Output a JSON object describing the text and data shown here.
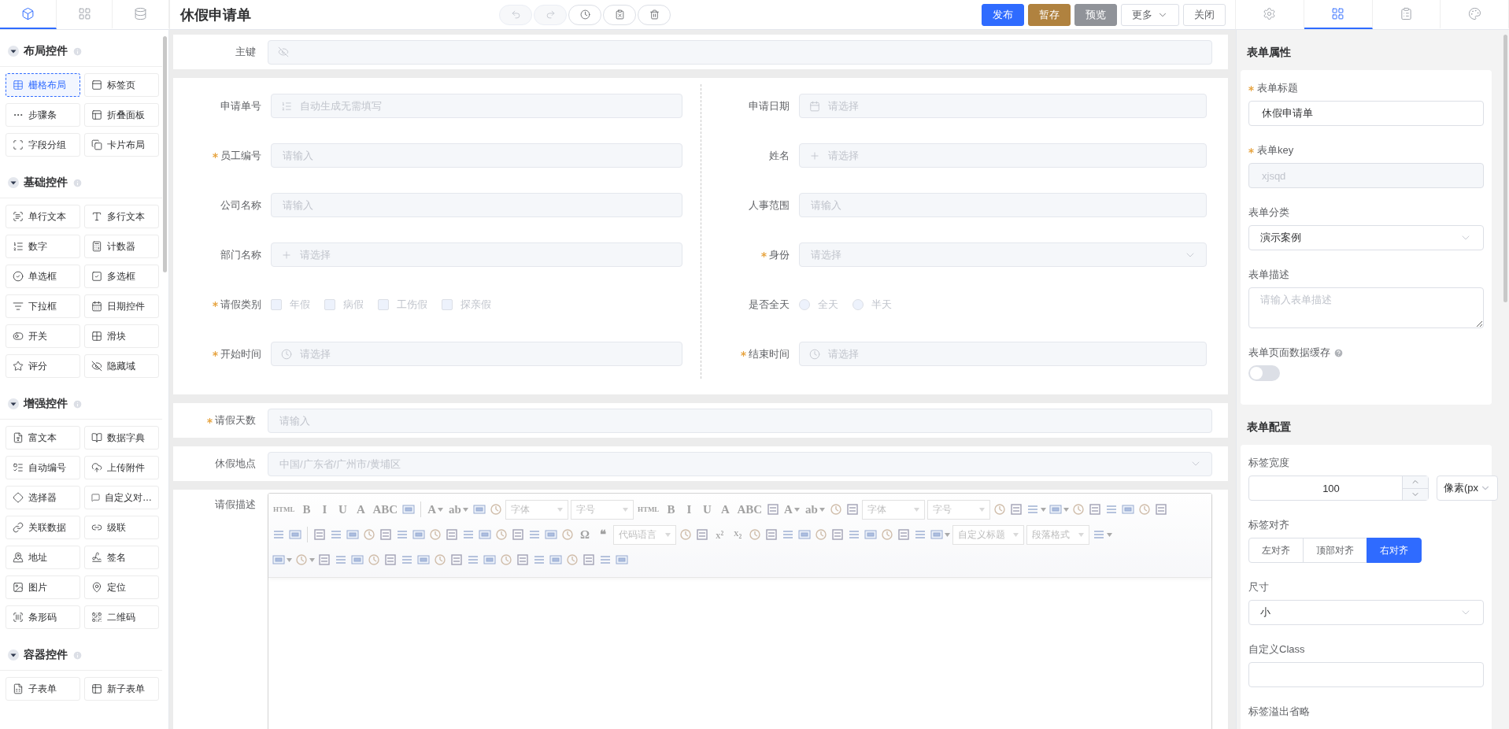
{
  "left_tabs": [
    {
      "kind": "cube",
      "selected": true
    },
    {
      "kind": "grid",
      "selected": false
    },
    {
      "kind": "database",
      "selected": false
    }
  ],
  "palette": [
    {
      "title": "布局控件",
      "items": [
        {
          "label": "栅格布局",
          "selected": true
        },
        {
          "label": "标签页",
          "selected": false
        },
        {
          "label": "步骤条",
          "selected": false
        },
        {
          "label": "折叠面板",
          "selected": false
        },
        {
          "label": "字段分组",
          "selected": false
        },
        {
          "label": "卡片布局",
          "selected": false
        }
      ]
    },
    {
      "title": "基础控件",
      "items": [
        {
          "label": "单行文本",
          "selected": false
        },
        {
          "label": "多行文本",
          "selected": false
        },
        {
          "label": "数字",
          "selected": false
        },
        {
          "label": "计数器",
          "selected": false
        },
        {
          "label": "单选框",
          "selected": false
        },
        {
          "label": "多选框",
          "selected": false
        },
        {
          "label": "下拉框",
          "selected": false
        },
        {
          "label": "日期控件",
          "selected": false
        },
        {
          "label": "开关",
          "selected": false
        },
        {
          "label": "滑块",
          "selected": false
        },
        {
          "label": "评分",
          "selected": false
        },
        {
          "label": "隐藏域",
          "selected": false
        }
      ]
    },
    {
      "title": "增强控件",
      "items": [
        {
          "label": "富文本",
          "selected": false
        },
        {
          "label": "数据字典",
          "selected": false
        },
        {
          "label": "自动编号",
          "selected": false
        },
        {
          "label": "上传附件",
          "selected": false
        },
        {
          "label": "选择器",
          "selected": false
        },
        {
          "label": "自定义对…",
          "selected": false
        },
        {
          "label": "关联数据",
          "selected": false
        },
        {
          "label": "级联",
          "selected": false
        },
        {
          "label": "地址",
          "selected": false
        },
        {
          "label": "签名",
          "selected": false
        },
        {
          "label": "图片",
          "selected": false
        },
        {
          "label": "定位",
          "selected": false
        },
        {
          "label": "条形码",
          "selected": false
        },
        {
          "label": "二维码",
          "selected": false
        }
      ]
    },
    {
      "title": "容器控件",
      "items": [
        {
          "label": "子表单",
          "selected": false
        },
        {
          "label": "新子表单",
          "selected": false
        }
      ]
    }
  ],
  "header": {
    "title": "休假申请单",
    "tools": [
      {
        "kind": "undo",
        "disabled": true
      },
      {
        "kind": "redo",
        "disabled": true
      },
      {
        "kind": "history",
        "disabled": false
      },
      {
        "kind": "clipboard",
        "disabled": false
      },
      {
        "kind": "delete",
        "disabled": false
      }
    ],
    "actions": [
      {
        "label": "发布",
        "kind": "primary"
      },
      {
        "label": "暂存",
        "kind": "warning"
      },
      {
        "label": "预览",
        "kind": "info"
      },
      {
        "label": "更多",
        "kind": "dropdown"
      },
      {
        "label": "关闭",
        "kind": "plain"
      }
    ]
  },
  "right_tabs": [
    {
      "kind": "settings",
      "selected": false
    },
    {
      "kind": "layout",
      "selected": true
    },
    {
      "kind": "list",
      "selected": false
    },
    {
      "kind": "palette",
      "selected": false
    }
  ],
  "canvas": {
    "blocks": [
      {
        "kind": "row",
        "field": {
          "kind": "hidden",
          "label": "主键",
          "required": false
        }
      },
      {
        "kind": "grid",
        "columns": [
          [
            {
              "kind": "auto",
              "label": "申请单号",
              "required": false,
              "placeholder": "自动生成无需填写"
            },
            {
              "kind": "input",
              "label": "员工编号",
              "required": true,
              "placeholder": "请输入"
            },
            {
              "kind": "input",
              "label": "公司名称",
              "required": false,
              "placeholder": "请输入"
            },
            {
              "kind": "picker",
              "label": "部门名称",
              "required": false,
              "placeholder": "请选择"
            },
            {
              "kind": "checkbox_group",
              "label": "请假类别",
              "required": true,
              "options": [
                {
                  "label": "年假",
                  "checked": false
                },
                {
                  "label": "病假",
                  "checked": false
                },
                {
                  "label": "工伤假",
                  "checked": false
                },
                {
                  "label": "探亲假",
                  "checked": false
                }
              ]
            },
            {
              "kind": "time",
              "label": "开始时间",
              "required": true,
              "placeholder": "请选择"
            }
          ],
          [
            {
              "kind": "date",
              "label": "申请日期",
              "required": false,
              "placeholder": "请选择"
            },
            {
              "kind": "picker",
              "label": "姓名",
              "required": false,
              "placeholder": "请选择"
            },
            {
              "kind": "input",
              "label": "人事范围",
              "required": false,
              "placeholder": "请输入"
            },
            {
              "kind": "select",
              "label": "身份",
              "required": true,
              "placeholder": "请选择"
            },
            {
              "kind": "radio_group",
              "label": "是否全天",
              "required": false,
              "options": [
                {
                  "label": "全天",
                  "selected": false
                },
                {
                  "label": "半天",
                  "selected": false
                }
              ]
            },
            {
              "kind": "time",
              "label": "结束时间",
              "required": true,
              "placeholder": "请选择"
            }
          ]
        ]
      },
      {
        "kind": "row",
        "field": {
          "kind": "input",
          "label": "请假天数",
          "required": true,
          "placeholder": "请输入"
        }
      },
      {
        "kind": "row",
        "field": {
          "kind": "cascader",
          "label": "休假地点",
          "required": false,
          "placeholder": "中国/广东省/广州市/黄埔区"
        }
      },
      {
        "kind": "editor",
        "label": "请假描述",
        "required": false,
        "toolbar": [
          [
            {
              "kind": "glyph",
              "text": "HTML"
            },
            {
              "kind": "glyph",
              "text": "B"
            },
            {
              "kind": "glyph",
              "text": "I"
            },
            {
              "kind": "glyph",
              "text": "U"
            },
            {
              "kind": "glyph",
              "text": "A"
            },
            {
              "kind": "glyph",
              "text": "ABC"
            },
            {
              "kind": "icon"
            },
            {
              "kind": "sep"
            },
            {
              "kind": "glyph",
              "text": "A",
              "dropdown": true
            },
            {
              "kind": "glyph",
              "text": "ab",
              "dropdown": true
            },
            {
              "kind": "icon"
            },
            {
              "kind": "icon"
            },
            {
              "kind": "select",
              "text": "字体"
            },
            {
              "kind": "select",
              "text": "字号"
            },
            {
              "kind": "glyph",
              "text": "HTML"
            },
            {
              "kind": "glyph",
              "text": "B"
            },
            {
              "kind": "glyph",
              "text": "I"
            },
            {
              "kind": "glyph",
              "text": "U"
            },
            {
              "kind": "glyph",
              "text": "A"
            },
            {
              "kind": "glyph",
              "text": "ABC"
            },
            {
              "kind": "icon"
            },
            {
              "kind": "glyph",
              "text": "A",
              "dropdown": true
            },
            {
              "kind": "glyph",
              "text": "ab",
              "dropdown": true
            },
            {
              "kind": "icon"
            },
            {
              "kind": "icon"
            },
            {
              "kind": "select",
              "text": "字体"
            },
            {
              "kind": "select",
              "text": "字号"
            },
            {
              "kind": "icon"
            },
            {
              "kind": "icon"
            },
            {
              "kind": "icon",
              "dropdown": true
            },
            {
              "kind": "icon",
              "dropdown": true
            },
            {
              "kind": "icon"
            },
            {
              "kind": "icon"
            },
            {
              "kind": "icon"
            },
            {
              "kind": "icon"
            },
            {
              "kind": "icon"
            },
            {
              "kind": "icon"
            }
          ],
          [
            {
              "kind": "icon"
            },
            {
              "kind": "icon"
            },
            {
              "kind": "sep"
            },
            {
              "kind": "icon"
            },
            {
              "kind": "icon"
            },
            {
              "kind": "icon"
            },
            {
              "kind": "icon"
            },
            {
              "kind": "icon"
            },
            {
              "kind": "icon"
            },
            {
              "kind": "icon"
            },
            {
              "kind": "icon"
            },
            {
              "kind": "icon"
            },
            {
              "kind": "icon"
            },
            {
              "kind": "icon"
            },
            {
              "kind": "icon"
            },
            {
              "kind": "icon"
            },
            {
              "kind": "icon"
            },
            {
              "kind": "icon"
            },
            {
              "kind": "icon"
            },
            {
              "kind": "glyph",
              "text": "Ω"
            },
            {
              "kind": "glyph",
              "text": "❝"
            },
            {
              "kind": "select",
              "text": "代码语言"
            },
            {
              "kind": "icon"
            },
            {
              "kind": "icon"
            },
            {
              "kind": "glyph",
              "text": "X$^{2}$"
            },
            {
              "kind": "glyph",
              "text": "X$_{2}$"
            },
            {
              "kind": "icon"
            },
            {
              "kind": "icon"
            },
            {
              "kind": "icon"
            },
            {
              "kind": "icon"
            },
            {
              "kind": "icon"
            },
            {
              "kind": "icon"
            },
            {
              "kind": "icon"
            },
            {
              "kind": "icon"
            },
            {
              "kind": "icon"
            },
            {
              "kind": "icon"
            },
            {
              "kind": "icon"
            },
            {
              "kind": "icon",
              "dropdown": true
            },
            {
              "kind": "select",
              "text": "自定义标题"
            },
            {
              "kind": "select",
              "text": "段落格式"
            },
            {
              "kind": "icon",
              "dropdown": true
            }
          ],
          [
            {
              "kind": "icon",
              "dropdown": true
            },
            {
              "kind": "icon",
              "dropdown": true
            },
            {
              "kind": "icon"
            },
            {
              "kind": "icon"
            },
            {
              "kind": "icon"
            },
            {
              "kind": "icon"
            },
            {
              "kind": "icon"
            },
            {
              "kind": "icon"
            },
            {
              "kind": "icon"
            },
            {
              "kind": "icon"
            },
            {
              "kind": "icon"
            },
            {
              "kind": "icon"
            },
            {
              "kind": "icon"
            },
            {
              "kind": "icon"
            },
            {
              "kind": "icon"
            },
            {
              "kind": "icon"
            },
            {
              "kind": "icon"
            },
            {
              "kind": "icon"
            },
            {
              "kind": "icon"
            },
            {
              "kind": "icon"
            },
            {
              "kind": "icon"
            }
          ]
        ]
      }
    ]
  },
  "properties": {
    "title": "表单属性",
    "fields": [
      {
        "kind": "input",
        "label": "表单标题",
        "required": true,
        "help": false,
        "disabled": false,
        "value": "休假申请单"
      },
      {
        "kind": "input",
        "label": "表单key",
        "required": true,
        "help": false,
        "disabled": true,
        "value": "xjsqd"
      },
      {
        "kind": "select",
        "label": "表单分类",
        "required": false,
        "help": false,
        "value": "演示案例"
      },
      {
        "kind": "textarea",
        "label": "表单描述",
        "required": false,
        "help": false,
        "placeholder": "请输入表单描述"
      },
      {
        "kind": "switch",
        "label": "表单页面数据缓存",
        "required": false,
        "help": true,
        "on": false
      }
    ]
  },
  "config": {
    "title": "表单配置",
    "fields": [
      {
        "kind": "number",
        "label": "标签宽度",
        "value": "100",
        "unit": "像素(px"
      },
      {
        "kind": "segmented",
        "label": "标签对齐",
        "options": [
          {
            "label": "左对齐",
            "selected": false
          },
          {
            "label": "顶部对齐",
            "selected": false
          },
          {
            "label": "右对齐",
            "selected": true
          }
        ]
      },
      {
        "kind": "select",
        "label": "尺寸",
        "value": "小"
      },
      {
        "kind": "input",
        "label": "自定义Class"
      },
      {
        "kind": "label",
        "label": "标签溢出省略"
      }
    ]
  }
}
